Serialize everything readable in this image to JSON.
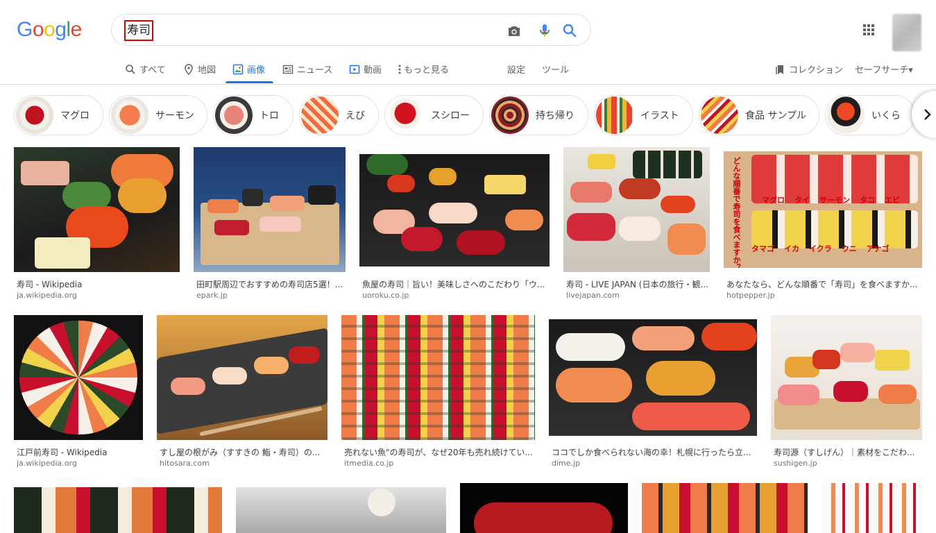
{
  "logo": {
    "letters": [
      "G",
      "o",
      "o",
      "g",
      "l",
      "e"
    ]
  },
  "search": {
    "query": "寿司"
  },
  "nav": {
    "all": "すべて",
    "maps": "地図",
    "images": "画像",
    "news": "ニュース",
    "videos": "動画",
    "more": "もっと見る",
    "settings": "設定",
    "tools": "ツール",
    "collections": "コレクション",
    "safesearch": "セーフサーチ▾"
  },
  "chips": [
    "マグロ",
    "サーモン",
    "トロ",
    "えび",
    "スシロー",
    "持ち帰り",
    "イラスト",
    "食品 サンプル",
    "いくら"
  ],
  "results_row1": [
    {
      "title": "寿司 - Wikipedia",
      "site": "ja.wikipedia.org"
    },
    {
      "title": "田町駅周辺でおすすめの寿司店5選！...",
      "site": "epark.jp"
    },
    {
      "title": "魚屋の寿司｜旨い！美味しさへのこだわり「ウ...",
      "site": "uoroku.co.jp"
    },
    {
      "title": "寿司 - LIVE JAPAN (日本の旅行・観...",
      "site": "livejapan.com"
    },
    {
      "title": "あなたなら、どんな順番で「寿司」を食べますか...",
      "site": "hotpepper.jp"
    }
  ],
  "results_row2": [
    {
      "title": "江戸前寿司 - Wikipedia",
      "site": "ja.wikipedia.org"
    },
    {
      "title": "すし屋の根がみ（すすきの 鮨・寿司）の...",
      "site": "hitosara.com"
    },
    {
      "title": "売れない魚\"の寿司が、なぜ20年も売れ続けてい...",
      "site": "itmedia.co.jp"
    },
    {
      "title": "ココでしか食べられない海の幸！札幌に行ったら立...",
      "site": "dime.jp"
    },
    {
      "title": "寿司源（すしげん）｜素材をこだわ...",
      "site": "sushigen.jp"
    }
  ],
  "image4_overlay": {
    "side_text": "どんな順番で寿司を食べますか？",
    "row1": [
      "マグロ",
      "タイ",
      "サーモン",
      "タコ",
      "エビ"
    ],
    "row2": [
      "タマゴ",
      "イカ",
      "イクラ",
      "ウニ",
      "アナゴ"
    ]
  },
  "colors": {
    "accent": "#1a73e8",
    "query_box": "#e00000"
  }
}
